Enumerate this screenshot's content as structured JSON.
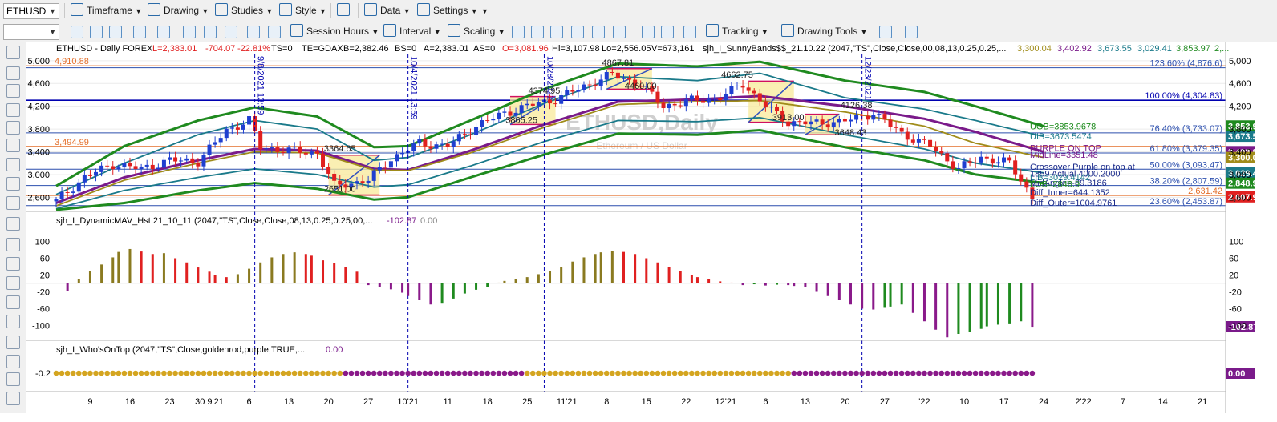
{
  "toolbar1": {
    "symbol": "ETHUSD",
    "items": [
      "Timeframe",
      "Drawing",
      "Studies",
      "Style",
      "Data",
      "Settings"
    ]
  },
  "toolbar2": {
    "items": [
      "Session Hours",
      "Interval",
      "Scaling",
      "Tracking",
      "Drawing Tools"
    ]
  },
  "header": {
    "title": "ETHUSD - Daily FOREX",
    "last": "L=2,383.01",
    "chg": "-704.07",
    "chgpct": "-22.81%",
    "ts": "TS=0",
    "te": "TE=GDAX",
    "bid": "B=2,382.46",
    "bs": "BS=0",
    "ask": "A=2,383.01",
    "as": "AS=0",
    "open": "O=3,081.96",
    "hi": "Hi=3,107.98",
    "lo": "Lo=2,556.05",
    "vol": "V=673,161",
    "study": "sjh_I_SunnyBands$$_21.10.22 (2047,\"TS\",Close,Close,00,08,13,0.25,0.25,...",
    "v1": "3,300.04",
    "v2": "3,402.92",
    "v3": "3,673.55",
    "v4": "3,029.41",
    "v5": "3,853.97",
    "v6": "2,..."
  },
  "watermark": {
    "symbol": "ETHUSD,Daily",
    "name": "Ethereum / US Dollar"
  },
  "fib_levels": [
    {
      "label": "123.60% (4,876.6)",
      "price": 4876.6,
      "color": "#2c4fae"
    },
    {
      "label": "100.00% (4,304.83)",
      "price": 4304.83,
      "color": "#0000b0"
    },
    {
      "label": "76.40% (3,733.07)",
      "price": 3733.07,
      "color": "#2c4fae"
    },
    {
      "label": "61.80% (3,379.35)",
      "price": 3379.35,
      "color": "#2c4fae"
    },
    {
      "label": "50.00% (3,093.47)",
      "price": 3093.47,
      "color": "#2c4fae"
    },
    {
      "label": "38.20% (2,807.59)",
      "price": 2807.59,
      "color": "#2c4fae"
    },
    {
      "label": "23.60% (2,453.87)",
      "price": 2453.87,
      "color": "#2c4fae"
    }
  ],
  "hlines": [
    {
      "label": "4,910.88",
      "price": 4910.88,
      "color": "#e46f2a"
    },
    {
      "label": "3,494.99",
      "price": 3494.99,
      "color": "#e46f2a"
    },
    {
      "label": "2,631.42",
      "price": 2631.42,
      "color": "#e46f2a"
    }
  ],
  "price_annotations": [
    {
      "text": "4867.81",
      "date": "2021-11-10",
      "price": 4867.81
    },
    {
      "text": "4374.95",
      "date": "2021-10-28",
      "price": 4374.95
    },
    {
      "text": "4460.00",
      "date": "2021-11-14",
      "price": 4460.0
    },
    {
      "text": "4662.75",
      "date": "2021-12-01",
      "price": 4662.75
    },
    {
      "text": "4126.38",
      "date": "2021-12-22",
      "price": 4126.38
    },
    {
      "text": "3913.00",
      "date": "2021-12-10",
      "price": 3913.0
    },
    {
      "text": "3865.25",
      "date": "2021-10-24",
      "price": 3865.25
    },
    {
      "text": "3648.43",
      "date": "2021-12-21",
      "price": 3648.43
    },
    {
      "text": "3364.65",
      "date": "2021-09-22",
      "price": 3364.65
    },
    {
      "text": "2651.00",
      "date": "2021-09-22",
      "price": 2651.0
    }
  ],
  "vlines": [
    {
      "label": "9/8/2021 13:59",
      "date": "2021-09-07"
    },
    {
      "label": "10/4/2021 13:59",
      "date": "2021-10-04"
    },
    {
      "label": "10/28/2021",
      "date": "2021-10-28"
    },
    {
      "label": "12/23/2021",
      "date": "2021-12-23"
    }
  ],
  "sunny_labels": [
    {
      "text": "UOB=3853.9678",
      "color": "#1a8a1a",
      "price": 3853.97
    },
    {
      "text": "UIB=3673.5474",
      "color": "#1a7a8a",
      "price": 3673.55
    },
    {
      "text": "PURPLE ON TOP",
      "color": "#7a1a8a",
      "price": 3470
    },
    {
      "text": "MidLine=3351.48",
      "color": "#7a1a8a",
      "price": 3351.48
    },
    {
      "text": "Crossover Purple on top at",
      "color": "#1a2a8a",
      "price": 3140
    },
    {
      "text": "1859 Actual 4000.2000",
      "color": "#1a2a8a",
      "price": 3020
    },
    {
      "text": "LIB=3029.4142",
      "color": "#1a7a8a",
      "price": 2960
    },
    {
      "text": "MidAngle=-89.3186",
      "color": "#1a2a8a",
      "price": 2860
    },
    {
      "text": "LOB=2848.9",
      "color": "#1a8a1a",
      "price": 2840
    },
    {
      "text": "Diff_Inner=644.1352",
      "color": "#1a2a8a",
      "price": 2690
    },
    {
      "text": "Diff_Outer=1004.9761",
      "color": "#1a2a8a",
      "price": 2510
    }
  ],
  "right_tags": [
    {
      "text": "3,853.9",
      "color": "#1f8a1f",
      "price": 3853.97
    },
    {
      "text": "3,673.5",
      "color": "#1a7a8a",
      "price": 3673.55
    },
    {
      "text": "3,402.9",
      "color": "#7a1a8a",
      "price": 3402.92
    },
    {
      "text": "3,300.0",
      "color": "#a08c1a",
      "price": 3300.04
    },
    {
      "text": "3,029.4",
      "color": "#1a7a8a",
      "price": 3029.41
    },
    {
      "text": "2,848.9",
      "color": "#1f8a1f",
      "price": 2848.9
    },
    {
      "text": "2,607.9",
      "color": "#e02020",
      "price": 2607.9
    }
  ],
  "price_axis": {
    "ticks": [
      "5,000",
      "4,600",
      "4,200",
      "3,800",
      "3,400",
      "3,000",
      "2,600"
    ],
    "values": [
      5000,
      4600,
      4200,
      3800,
      3400,
      3000,
      2600
    ],
    "min": 2380,
    "max": 5110
  },
  "panel2": {
    "title": "sjh_I_DynamicMAV_Hst 21_10_11 (2047,\"TS\",Close,Close,08,13,0.25,0.25,00,...",
    "v1": "-102.87",
    "v2": "0.00",
    "tag": "-102.87",
    "ticks": [
      "100",
      "60",
      "20",
      "-20",
      "-60",
      "-100"
    ],
    "tick_values": [
      100,
      60,
      20,
      -20,
      -60,
      -100
    ]
  },
  "panel3": {
    "title": "sjh_I_Who'sOnTop (2047,\"TS\",Close,goldenrod,purple,TRUE,...",
    "v1": "0.00",
    "tick": "-0.2",
    "tag": "0.00"
  },
  "xaxis": {
    "labels": [
      {
        "text": "9",
        "date": "2021-08-09"
      },
      {
        "text": "16",
        "date": "2021-08-16"
      },
      {
        "text": "23",
        "date": "2021-08-23"
      },
      {
        "text": "30 9'21",
        "date": "2021-08-30"
      },
      {
        "text": "6",
        "date": "2021-09-06"
      },
      {
        "text": "13",
        "date": "2021-09-13"
      },
      {
        "text": "20",
        "date": "2021-09-20"
      },
      {
        "text": "27",
        "date": "2021-09-27"
      },
      {
        "text": "10'21",
        "date": "2021-10-04"
      },
      {
        "text": "11",
        "date": "2021-10-11"
      },
      {
        "text": "18",
        "date": "2021-10-18"
      },
      {
        "text": "25",
        "date": "2021-10-25"
      },
      {
        "text": "11'21",
        "date": "2021-11-01"
      },
      {
        "text": "8",
        "date": "2021-11-08"
      },
      {
        "text": "15",
        "date": "2021-11-15"
      },
      {
        "text": "22",
        "date": "2021-11-22"
      },
      {
        "text": "12'21",
        "date": "2021-11-29"
      },
      {
        "text": "6",
        "date": "2021-12-06"
      },
      {
        "text": "13",
        "date": "2021-12-13"
      },
      {
        "text": "20",
        "date": "2021-12-20"
      },
      {
        "text": "27",
        "date": "2021-12-27"
      },
      {
        "text": "'22",
        "date": "2022-01-03"
      },
      {
        "text": "10",
        "date": "2022-01-10"
      },
      {
        "text": "17",
        "date": "2022-01-17"
      },
      {
        "text": "24",
        "date": "2022-01-24"
      },
      {
        "text": "2'22",
        "date": "2022-01-31"
      },
      {
        "text": "7",
        "date": "2022-02-07"
      },
      {
        "text": "14",
        "date": "2022-02-14"
      },
      {
        "text": "21",
        "date": "2022-02-21"
      }
    ]
  },
  "chart_data": {
    "type": "line",
    "title": "ETHUSD - Daily FOREX",
    "x_range": [
      "2021-08-03",
      "2022-02-25"
    ],
    "price_range": [
      2380,
      5110
    ],
    "series": [
      {
        "name": "UOB",
        "color": "#1f8a1f",
        "points": [
          [
            "2021-08-03",
            2800
          ],
          [
            "2021-08-15",
            3500
          ],
          [
            "2021-08-28",
            3950
          ],
          [
            "2021-09-07",
            4180
          ],
          [
            "2021-09-18",
            4020
          ],
          [
            "2021-09-28",
            3480
          ],
          [
            "2021-10-04",
            3500
          ],
          [
            "2021-10-15",
            3950
          ],
          [
            "2021-10-28",
            4500
          ],
          [
            "2021-11-10",
            4950
          ],
          [
            "2021-11-24",
            4900
          ],
          [
            "2021-12-05",
            4980
          ],
          [
            "2021-12-20",
            4650
          ],
          [
            "2022-01-03",
            4450
          ],
          [
            "2022-01-12",
            4200
          ],
          [
            "2022-01-24",
            3850
          ]
        ]
      },
      {
        "name": "UIB",
        "color": "#1a7a8a",
        "points": [
          [
            "2021-08-03",
            2650
          ],
          [
            "2021-08-15",
            3200
          ],
          [
            "2021-08-28",
            3700
          ],
          [
            "2021-09-07",
            3950
          ],
          [
            "2021-09-18",
            3800
          ],
          [
            "2021-09-28",
            3250
          ],
          [
            "2021-10-04",
            3300
          ],
          [
            "2021-10-15",
            3700
          ],
          [
            "2021-10-28",
            4250
          ],
          [
            "2021-11-10",
            4720
          ],
          [
            "2021-11-24",
            4650
          ],
          [
            "2021-12-05",
            4780
          ],
          [
            "2021-12-20",
            4350
          ],
          [
            "2022-01-03",
            4150
          ],
          [
            "2022-01-12",
            3950
          ],
          [
            "2022-01-24",
            3670
          ]
        ]
      },
      {
        "name": "MidLine",
        "color": "#7a1a8a",
        "points": [
          [
            "2021-08-03",
            2500
          ],
          [
            "2021-08-15",
            2950
          ],
          [
            "2021-08-28",
            3250
          ],
          [
            "2021-09-07",
            3450
          ],
          [
            "2021-09-18",
            3420
          ],
          [
            "2021-09-28",
            3100
          ],
          [
            "2021-10-04",
            3080
          ],
          [
            "2021-10-15",
            3420
          ],
          [
            "2021-10-28",
            3880
          ],
          [
            "2021-11-10",
            4280
          ],
          [
            "2021-11-24",
            4320
          ],
          [
            "2021-12-05",
            4380
          ],
          [
            "2021-12-20",
            4200
          ],
          [
            "2022-01-03",
            3980
          ],
          [
            "2022-01-12",
            3750
          ],
          [
            "2022-01-24",
            3400
          ]
        ]
      },
      {
        "name": "Avg",
        "color": "#a08c1a",
        "points": [
          [
            "2021-08-03",
            2450
          ],
          [
            "2021-08-15",
            2900
          ],
          [
            "2021-08-28",
            3200
          ],
          [
            "2021-09-07",
            3400
          ],
          [
            "2021-09-18",
            3380
          ],
          [
            "2021-09-28",
            3080
          ],
          [
            "2021-10-04",
            3070
          ],
          [
            "2021-10-15",
            3380
          ],
          [
            "2021-10-28",
            3830
          ],
          [
            "2021-11-10",
            4230
          ],
          [
            "2021-11-24",
            4280
          ],
          [
            "2021-12-05",
            4300
          ],
          [
            "2021-12-20",
            4100
          ],
          [
            "2022-01-03",
            3850
          ],
          [
            "2022-01-12",
            3550
          ],
          [
            "2022-01-24",
            3300
          ]
        ]
      },
      {
        "name": "LIB",
        "color": "#1a7a8a",
        "points": [
          [
            "2021-08-03",
            2400
          ],
          [
            "2021-08-15",
            2720
          ],
          [
            "2021-08-28",
            2950
          ],
          [
            "2021-09-07",
            3100
          ],
          [
            "2021-09-18",
            3000
          ],
          [
            "2021-09-28",
            2780
          ],
          [
            "2021-10-04",
            2820
          ],
          [
            "2021-10-15",
            3150
          ],
          [
            "2021-10-28",
            3580
          ],
          [
            "2021-11-10",
            3950
          ],
          [
            "2021-11-24",
            3930
          ],
          [
            "2021-12-05",
            4000
          ],
          [
            "2021-12-20",
            3700
          ],
          [
            "2022-01-03",
            3450
          ],
          [
            "2022-01-12",
            3200
          ],
          [
            "2022-01-24",
            3030
          ]
        ]
      },
      {
        "name": "LOB",
        "color": "#1f8a1f",
        "points": [
          [
            "2021-08-03",
            2380
          ],
          [
            "2021-08-15",
            2500
          ],
          [
            "2021-08-28",
            2720
          ],
          [
            "2021-09-07",
            2850
          ],
          [
            "2021-09-18",
            2750
          ],
          [
            "2021-09-28",
            2560
          ],
          [
            "2021-10-04",
            2600
          ],
          [
            "2021-10-15",
            2950
          ],
          [
            "2021-10-28",
            3350
          ],
          [
            "2021-11-10",
            3720
          ],
          [
            "2021-11-24",
            3700
          ],
          [
            "2021-12-05",
            3780
          ],
          [
            "2021-12-20",
            3480
          ],
          [
            "2022-01-03",
            3250
          ],
          [
            "2022-01-12",
            3000
          ],
          [
            "2022-01-24",
            2850
          ]
        ]
      }
    ],
    "price": [
      [
        "2021-08-03",
        2530
      ],
      [
        "2021-08-08",
        2950
      ],
      [
        "2021-08-13",
        3180
      ],
      [
        "2021-08-18",
        3100
      ],
      [
        "2021-08-23",
        3250
      ],
      [
        "2021-08-28",
        3230
      ],
      [
        "2021-09-02",
        3780
      ],
      [
        "2021-09-06",
        3950
      ],
      [
        "2021-09-08",
        3480
      ],
      [
        "2021-09-13",
        3420
      ],
      [
        "2021-09-18",
        3380
      ],
      [
        "2021-09-21",
        2800
      ],
      [
        "2021-09-27",
        2900
      ],
      [
        "2021-10-01",
        3280
      ],
      [
        "2021-10-06",
        3550
      ],
      [
        "2021-10-11",
        3500
      ],
      [
        "2021-10-16",
        3860
      ],
      [
        "2021-10-21",
        4080
      ],
      [
        "2021-10-26",
        4230
      ],
      [
        "2021-10-30",
        4320
      ],
      [
        "2021-11-04",
        4550
      ],
      [
        "2021-11-09",
        4760
      ],
      [
        "2021-11-14",
        4580
      ],
      [
        "2021-11-18",
        4200
      ],
      [
        "2021-11-23",
        4300
      ],
      [
        "2021-11-28",
        4350
      ],
      [
        "2021-12-02",
        4600
      ],
      [
        "2021-12-06",
        4200
      ],
      [
        "2021-12-10",
        3920
      ],
      [
        "2021-12-15",
        3900
      ],
      [
        "2021-12-20",
        3940
      ],
      [
        "2021-12-25",
        4080
      ],
      [
        "2021-12-30",
        3720
      ],
      [
        "2022-01-04",
        3500
      ],
      [
        "2022-01-09",
        3100
      ],
      [
        "2022-01-13",
        3300
      ],
      [
        "2022-01-18",
        3200
      ],
      [
        "2022-01-22",
        2600
      ]
    ],
    "histogram": {
      "name": "DynamicMAV_Hst",
      "range": [
        -125,
        125
      ],
      "values": [
        -18,
        10,
        30,
        45,
        62,
        75,
        82,
        76,
        70,
        72,
        60,
        50,
        38,
        28,
        20,
        15,
        22,
        35,
        50,
        62,
        70,
        74,
        70,
        66,
        55,
        48,
        40,
        28,
        -4,
        -8,
        -14,
        -22,
        -30,
        -40,
        -50,
        -48,
        -36,
        -24,
        -15,
        -8,
        2,
        6,
        10,
        15,
        22,
        30,
        40,
        52,
        62,
        70,
        74,
        78,
        75,
        70,
        60,
        50,
        40,
        30,
        20,
        15,
        10,
        5,
        2,
        -4,
        -2,
        -5,
        -3,
        -4,
        -6,
        -8,
        -20,
        -30,
        -40,
        -50,
        -60,
        -62,
        -58,
        -55,
        -50,
        -70,
        -90,
        -110,
        -128,
        -120,
        -115,
        -108,
        -102,
        -98,
        -95,
        -90,
        -103
      ]
    },
    "dots": {
      "name": "Who'sOnTop",
      "value": -0.2,
      "pattern": "gold until 2021-09-23, purple until 2021-10-25, gold until 2021-12-11, purple after"
    }
  }
}
